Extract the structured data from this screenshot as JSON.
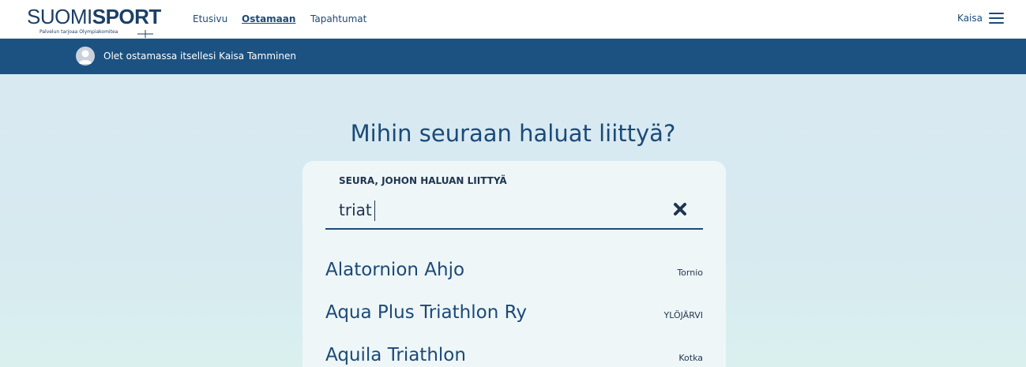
{
  "brand": {
    "logo_light": "SUOMI",
    "logo_bold": "SPORT",
    "tagline": "Palvelun tarjoaa Olympiakomitea"
  },
  "nav": {
    "items": [
      {
        "label": "Etusivu",
        "active": false
      },
      {
        "label": "Ostamaan",
        "active": true
      },
      {
        "label": "Tapahtumat",
        "active": false
      }
    ]
  },
  "user": {
    "name": "Kaisa"
  },
  "buyer_bar": {
    "text": "Olet ostamassa itsellesi Kaisa Tamminen"
  },
  "page": {
    "heading": "Mihin seuraan haluat liittyä?"
  },
  "search": {
    "label": "SEURA, JOHON HALUAN LIITTYÄ",
    "value": "triat"
  },
  "results": [
    {
      "name": "Alatornion Ahjo",
      "city": "Tornio"
    },
    {
      "name": "Aqua Plus Triathlon Ry",
      "city": "YLÖJÄRVI"
    },
    {
      "name": "Aquila Triathlon",
      "city": "Kotka"
    }
  ],
  "colors": {
    "brand_navy": "#1b4a77",
    "bar_blue": "#1b5281",
    "background": "#d9e9f2"
  }
}
